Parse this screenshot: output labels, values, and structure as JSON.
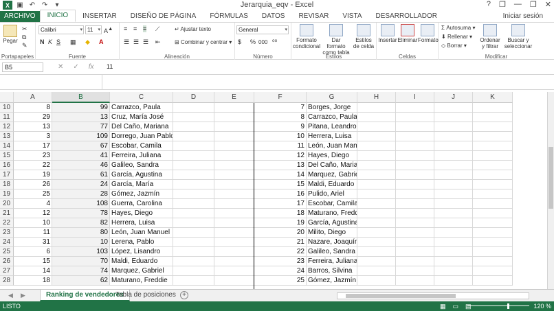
{
  "window": {
    "title": "Jerarquia_eqv - Excel",
    "logo": "X",
    "qat_icons": [
      "save-icon",
      "undo-icon",
      "redo-icon",
      "customize-icon"
    ],
    "controls": [
      "?",
      "❐",
      "—",
      "❐",
      "✕"
    ]
  },
  "tabs": {
    "file": "ARCHIVO",
    "items": [
      "INICIO",
      "INSERTAR",
      "DISEÑO DE PÁGINA",
      "FÓRMULAS",
      "DATOS",
      "REVISAR",
      "VISTA",
      "DESARROLLADOR"
    ],
    "active": "INICIO",
    "signin": "Iniciar sesión"
  },
  "ribbon": {
    "clipboard": {
      "paste": "Pegar",
      "label": "Portapapeles"
    },
    "font": {
      "name": "Calibri",
      "size": "11",
      "bold": "N",
      "italic": "K",
      "underline": "S",
      "label": "Fuente"
    },
    "alignment": {
      "wrap": "Ajustar texto",
      "merge": "Combinar y centrar",
      "label": "Alineación"
    },
    "number": {
      "format": "General",
      "currency": "$",
      "percent": "%",
      "thousands": "000",
      "label": "Número"
    },
    "styles": {
      "conditional": "Formato condicional",
      "table": "Dar formato como tabla",
      "cell": "Estilos de celda",
      "label": "Estilos"
    },
    "cells": {
      "insert": "Insertar",
      "delete": "Eliminar",
      "format": "Formato",
      "label": "Celdas"
    },
    "editing": {
      "autosum": "Autosuma",
      "fill": "Rellenar",
      "clear": "Borrar",
      "sort": "Ordenar y filtrar",
      "find": "Buscar y seleccionar",
      "label": "Modificar"
    }
  },
  "formula_bar": {
    "name_box": "B5",
    "cancel": "✕",
    "enter": "✓",
    "fx": "fx",
    "value": "11"
  },
  "grid": {
    "columns": [
      "A",
      "B",
      "C",
      "D",
      "E",
      "F",
      "G",
      "H",
      "I",
      "J",
      "K"
    ],
    "selected_column": "B",
    "rows": [
      {
        "n": "10",
        "a": "8",
        "b": "99",
        "c": "Carrazco, Paula",
        "f": "7",
        "g": "Borges, Jorge"
      },
      {
        "n": "11",
        "a": "29",
        "b": "13",
        "c": "Cruz, María José",
        "f": "8",
        "g": "Carrazco, Paula"
      },
      {
        "n": "12",
        "a": "13",
        "b": "77",
        "c": "Del Caño, Mariana",
        "f": "9",
        "g": "Pitana, Leandro"
      },
      {
        "n": "13",
        "a": "3",
        "b": "109",
        "c": "Dorrego, Juan Pablo",
        "f": "10",
        "g": "Herrera, Luisa"
      },
      {
        "n": "14",
        "a": "17",
        "b": "67",
        "c": "Escobar, Camila",
        "f": "11",
        "g": "León, Juan Manuel"
      },
      {
        "n": "15",
        "a": "23",
        "b": "41",
        "c": "Ferreira, Juliana",
        "f": "12",
        "g": "Hayes, Diego"
      },
      {
        "n": "16",
        "a": "22",
        "b": "46",
        "c": "Galileo, Sandra",
        "f": "13",
        "g": "Del Caño, Mariana"
      },
      {
        "n": "17",
        "a": "19",
        "b": "61",
        "c": "García, Agustina",
        "f": "14",
        "g": "Marquez, Gabriel"
      },
      {
        "n": "18",
        "a": "26",
        "b": "24",
        "c": "García, María",
        "f": "15",
        "g": "Maldi, Eduardo"
      },
      {
        "n": "19",
        "a": "25",
        "b": "28",
        "c": "Gómez, Jazmín",
        "f": "16",
        "g": "Pulido, Ariel"
      },
      {
        "n": "20",
        "a": "4",
        "b": "108",
        "c": "Guerra, Carolina",
        "f": "17",
        "g": "Escobar, Camila"
      },
      {
        "n": "21",
        "a": "12",
        "b": "78",
        "c": "Hayes, Diego",
        "f": "18",
        "g": "Maturano, Freddie"
      },
      {
        "n": "22",
        "a": "10",
        "b": "82",
        "c": "Herrera, Luisa",
        "f": "19",
        "g": "García, Agustina"
      },
      {
        "n": "23",
        "a": "11",
        "b": "80",
        "c": "León, Juan Manuel",
        "f": "20",
        "g": "Milito, Diego"
      },
      {
        "n": "24",
        "a": "31",
        "b": "10",
        "c": "Lerena, Pablo",
        "f": "21",
        "g": "Nazare, Joaquín"
      },
      {
        "n": "25",
        "a": "6",
        "b": "103",
        "c": "López, Lisandro",
        "f": "22",
        "g": "Galileo, Sandra"
      },
      {
        "n": "26",
        "a": "15",
        "b": "70",
        "c": "Maldi, Eduardo",
        "f": "23",
        "g": "Ferreira, Juliana"
      },
      {
        "n": "27",
        "a": "14",
        "b": "74",
        "c": "Marquez, Gabriel",
        "f": "24",
        "g": "Barros, Silvina"
      },
      {
        "n": "28",
        "a": "18",
        "b": "62",
        "c": "Maturano, Freddie",
        "f": "25",
        "g": "Gómez, Jazmín"
      }
    ]
  },
  "sheets": {
    "tabs": [
      "Ranking de vendedores",
      "Tabla de posiciones"
    ],
    "active": "Ranking de vendedores",
    "add": "+"
  },
  "status_bar": {
    "ready": "LISTO",
    "zoom": "120 %"
  },
  "colors": {
    "accent": "#217346"
  }
}
